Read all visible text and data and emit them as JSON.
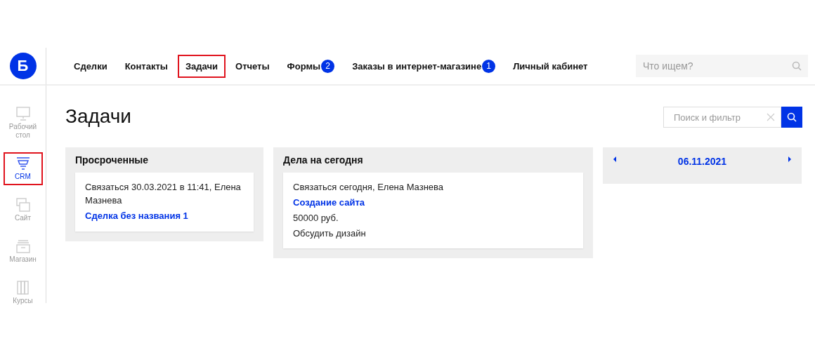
{
  "logo": {
    "letter": "Б"
  },
  "nav": [
    {
      "label": "Сделки",
      "highlighted": false
    },
    {
      "label": "Контакты",
      "highlighted": false
    },
    {
      "label": "Задачи",
      "highlighted": true
    },
    {
      "label": "Отчеты",
      "highlighted": false
    },
    {
      "label": "Формы",
      "highlighted": false,
      "badge": "2"
    },
    {
      "label": "Заказы в интернет-магазине",
      "highlighted": false,
      "badge": "1"
    },
    {
      "label": "Личный кабинет",
      "highlighted": false
    }
  ],
  "search": {
    "placeholder": "Что ищем?"
  },
  "sidebar": {
    "items": [
      {
        "kind": "monitor",
        "label": "Рабочий стол",
        "selected": false,
        "highlighted": false
      },
      {
        "kind": "funnel",
        "label": "CRM",
        "selected": true,
        "highlighted": true
      },
      {
        "kind": "windows",
        "label": "Сайт",
        "selected": false,
        "highlighted": false
      },
      {
        "kind": "drawer",
        "label": "Магазин",
        "selected": false,
        "highlighted": false
      },
      {
        "kind": "books",
        "label": "Курсы",
        "selected": false,
        "highlighted": false
      }
    ]
  },
  "page_title": "Задачи",
  "filter": {
    "placeholder": "Поиск и фильтр"
  },
  "panels": [
    {
      "title": "Просроченные",
      "tasks": [
        {
          "text": "Связаться 30.03.2021 в 11:41, Елена Мазнева",
          "link": "Сделка без названия 1"
        }
      ]
    },
    {
      "title": "Дела на сегодня",
      "tasks": [
        {
          "text": "Связаться сегодня, Елена Мазнева",
          "link": "Создание сайта",
          "lines": [
            "50000 руб.",
            "Обсудить дизайн"
          ]
        }
      ]
    }
  ],
  "calendar": {
    "date": "06.11.2021"
  }
}
